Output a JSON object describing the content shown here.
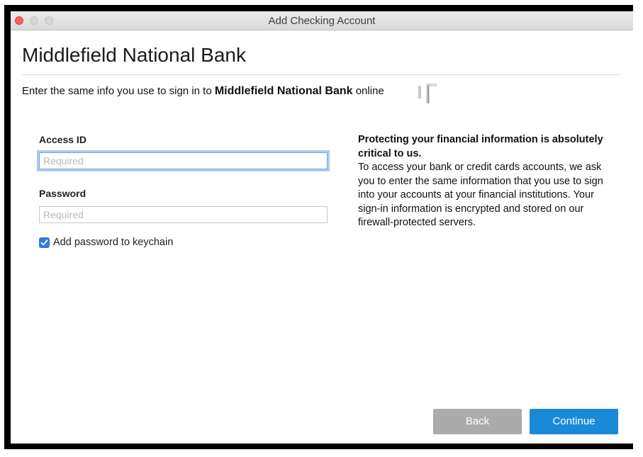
{
  "window": {
    "title": "Add Checking Account"
  },
  "header": {
    "bank_name": "Middlefield National Bank",
    "instruction_prefix": "Enter the same info you use to sign in to",
    "instruction_bank": "Middlefield National Bank",
    "instruction_suffix": "online"
  },
  "form": {
    "access_id_label": "Access ID",
    "access_id_placeholder": "Required",
    "access_id_value": "",
    "password_label": "Password",
    "password_placeholder": "Required",
    "password_value": "",
    "keychain_checked": true,
    "keychain_label": "Add password to keychain"
  },
  "info": {
    "heading": "Protecting your financial information is absolutely critical to us.",
    "body": "To access your bank or credit cards accounts, we ask you to enter the same information that you use to sign into your accounts at your financial institutions. Your sign-in information is encrypted and stored on our firewall-protected servers."
  },
  "buttons": {
    "back_label": "Back",
    "continue_label": "Continue"
  },
  "colors": {
    "accent": "#1a8ad8",
    "checkbox": "#2f7de1",
    "disabled_button": "#ababab",
    "close_button": "#fc5f57"
  }
}
